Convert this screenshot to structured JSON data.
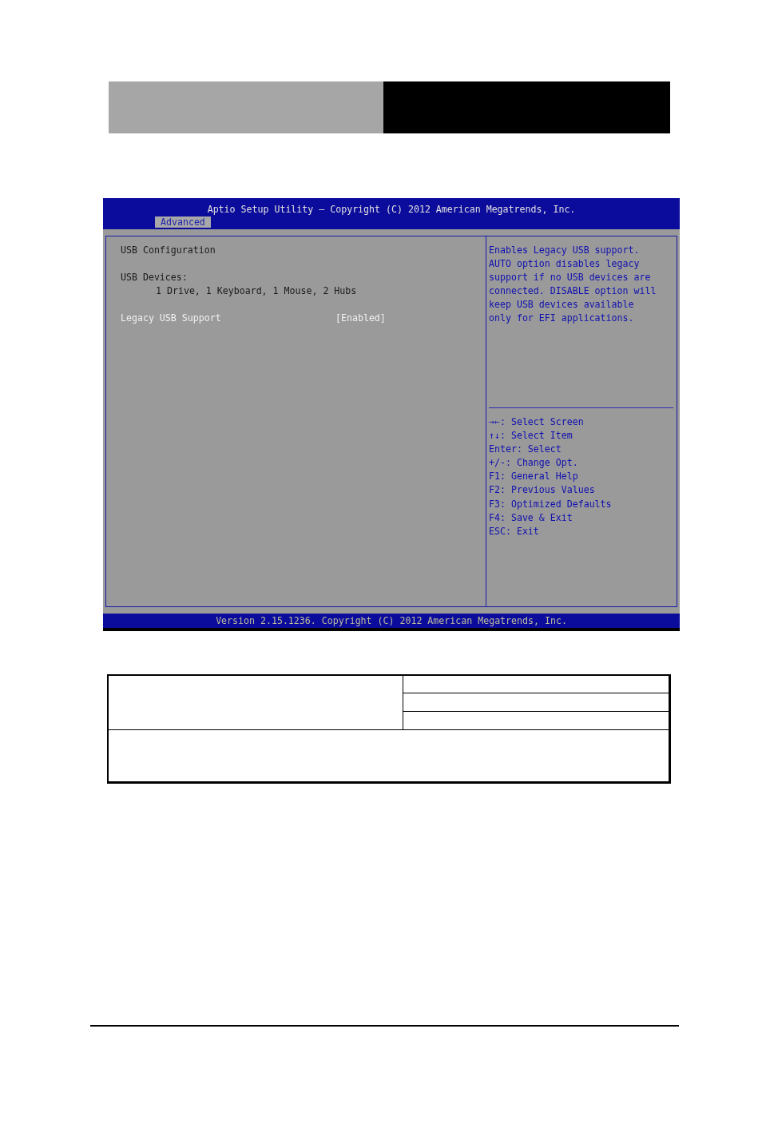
{
  "bios": {
    "title": "Aptio Setup Utility – Copyright (C) 2012 American Megatrends, Inc.",
    "tabs": [
      {
        "label": "Advanced",
        "selected": true
      }
    ],
    "groups": [
      [
        {
          "kind": "heading",
          "label": "USB Configuration"
        }
      ],
      [
        {
          "kind": "heading",
          "label": "USB Devices:"
        },
        {
          "kind": "detail",
          "label": "1 Drive, 1 Keyboard, 1 Mouse, 2 Hubs"
        }
      ],
      [
        {
          "kind": "setting",
          "label": "Legacy USB Support",
          "value": "[Enabled]",
          "selected": true
        }
      ]
    ],
    "help": "Enables Legacy USB support. AUTO option disables legacy support if no USB devices are connected. DISABLE option will keep USB devices available only for EFI applications.",
    "keys": [
      "→←: Select Screen",
      "↑↓: Select Item",
      "Enter: Select",
      "+/-: Change Opt.",
      "F1: General Help",
      "F2: Previous Values",
      "F3: Optimized Defaults",
      "F4: Save & Exit",
      "ESC: Exit"
    ],
    "footer": "Version 2.15.1236. Copyright (C) 2012 American Megatrends, Inc."
  }
}
